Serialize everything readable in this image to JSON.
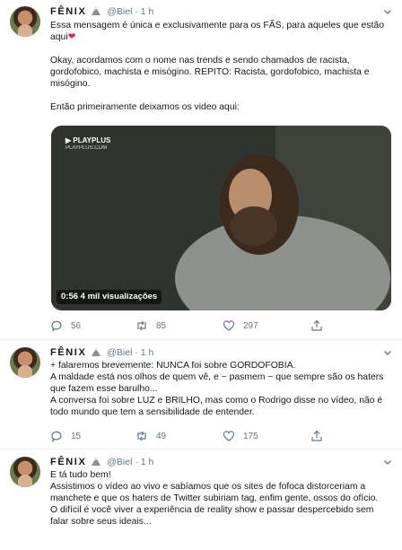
{
  "tweets": [
    {
      "name": "FÊNIX",
      "handle": "@Biel",
      "dot": "·",
      "time": "1 h",
      "lines": [
        "Essa mensagem é única e exclusivamente para os FÃS, para aqueles que estão aqui",
        "Okay, acordamos com o nome nas trends e sendo chamados de racista, gordofobico, machista e misógino. REPITO: Racista, gordofobico, machista e misógino.",
        "Então primeiramente deixamos os video aqui:"
      ],
      "heart": "❤",
      "video": {
        "logo": "PLAYPLUS",
        "logo_sub": "PLAYPLUS.COM",
        "meta": "0:56  4 mil visualizações"
      },
      "replies": "56",
      "retweets": "85",
      "likes": "297"
    },
    {
      "name": "FÊNIX",
      "handle": "@Biel",
      "dot": "·",
      "time": "1 h",
      "lines": [
        "+ falaremos brevemente: NUNCA foi sobre GORDOFOBIA.",
        "A maldade está nos olhos de quem vê, e ~ pasmem ~  que sempre são os haters que fazem esse barulho...",
        "A conversa foi sobre LUZ e BRILHO, mas como o Rodrigo disse no vídeo, não é todo mundo que tem a sensibilidade de entender."
      ],
      "replies": "15",
      "retweets": "49",
      "likes": "175"
    },
    {
      "name": "FÊNIX",
      "handle": "@Biel",
      "dot": "·",
      "time": "1 h",
      "lines": [
        "E tá tudo bem!",
        "Assistimos o vídeo ao vivo e sabíamos que os sites de fofoca distorceriam a manchete e que os haters de Twitter subiriam tag, enfim gente, ossos do ofício.",
        "O difícil é você viver a experiência de reality show e passar despercebido sem falar sobre seus ideais..."
      ]
    }
  ],
  "colors": {
    "secondary": "#657786",
    "heart": "#e0245e",
    "divider": "#e6ecf0"
  }
}
